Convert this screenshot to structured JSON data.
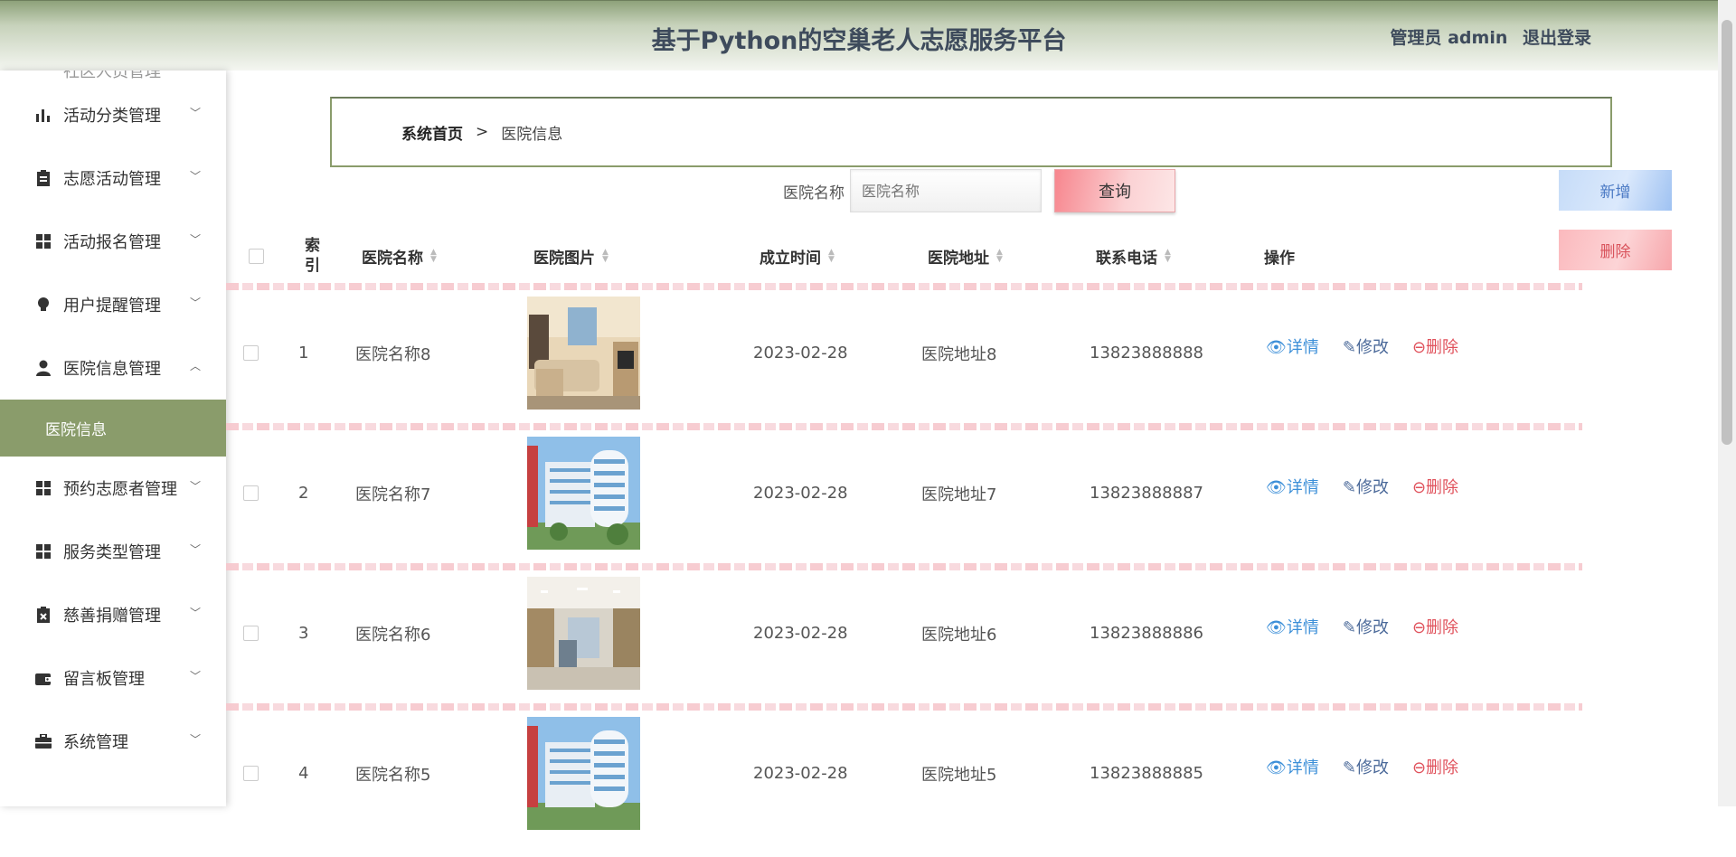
{
  "header": {
    "title": "基于Python的空巢老人志愿服务平台",
    "role": "管理员 admin",
    "logout": "退出登录"
  },
  "sidebar": {
    "partial_item": "社区人员管理",
    "items": [
      {
        "label": "活动分类管理",
        "icon": "bar-chart-icon"
      },
      {
        "label": "志愿活动管理",
        "icon": "clipboard-icon"
      },
      {
        "label": "活动报名管理",
        "icon": "grid-icon"
      },
      {
        "label": "用户提醒管理",
        "icon": "lightbulb-icon"
      },
      {
        "label": "医院信息管理",
        "icon": "user-icon"
      },
      {
        "label": "预约志愿者管理",
        "icon": "grid-icon"
      },
      {
        "label": "服务类型管理",
        "icon": "grid-icon"
      },
      {
        "label": "慈善捐赠管理",
        "icon": "clipboard-x-icon"
      },
      {
        "label": "留言板管理",
        "icon": "wallet-icon"
      },
      {
        "label": "系统管理",
        "icon": "briefcase-icon"
      }
    ],
    "active_sub": "医院信息"
  },
  "breadcrumb": {
    "home": "系统首页",
    "sep": ">",
    "current": "医院信息"
  },
  "search": {
    "label": "医院名称",
    "placeholder": "医院名称",
    "button": "查询"
  },
  "buttons": {
    "add": "新增",
    "delete": "删除"
  },
  "table": {
    "headers": {
      "index": "索引",
      "name": "医院名称",
      "image": "医院图片",
      "date": "成立时间",
      "address": "医院地址",
      "phone": "联系电话",
      "ops": "操作"
    },
    "actions": {
      "view": "详情",
      "edit": "修改",
      "delete": "删除"
    },
    "rows": [
      {
        "index": "1",
        "name": "医院名称8",
        "date": "2023-02-28",
        "address": "医院地址8",
        "phone": "13823888888",
        "img": "room"
      },
      {
        "index": "2",
        "name": "医院名称7",
        "date": "2023-02-28",
        "address": "医院地址7",
        "phone": "13823888887",
        "img": "building"
      },
      {
        "index": "3",
        "name": "医院名称6",
        "date": "2023-02-28",
        "address": "医院地址6",
        "phone": "13823888886",
        "img": "hall"
      },
      {
        "index": "4",
        "name": "医院名称5",
        "date": "2023-02-28",
        "address": "医院地址5",
        "phone": "13823888885",
        "img": "building"
      }
    ]
  }
}
